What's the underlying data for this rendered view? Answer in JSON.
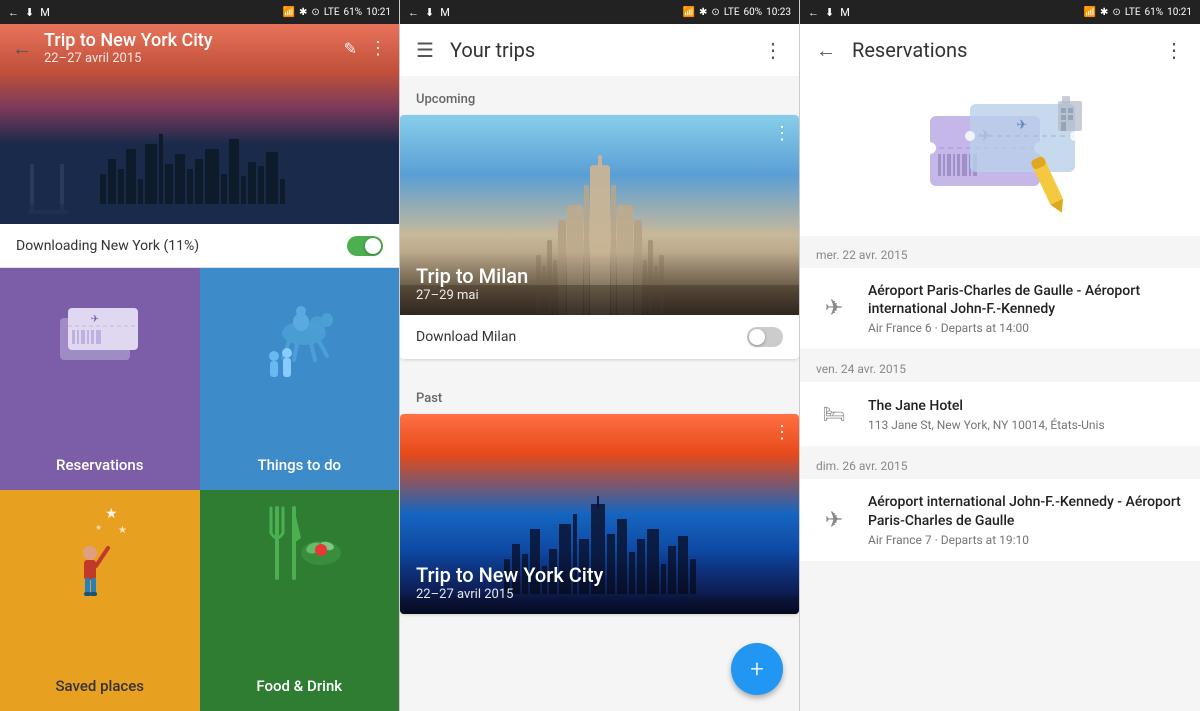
{
  "panel1": {
    "status": {
      "time": "10:21",
      "battery": "61%",
      "signal": "LTE"
    },
    "header": {
      "title": "Trip to New York City",
      "dates": "22–27 avril 2015"
    },
    "download": {
      "text": "Downloading New York (11%)",
      "toggle": "on"
    },
    "tiles": [
      {
        "id": "reservations",
        "label": "Reservations",
        "color": "purple"
      },
      {
        "id": "things-to-do",
        "label": "Things to do",
        "color": "blue"
      },
      {
        "id": "saved-places",
        "label": "Saved places",
        "color": "yellow"
      },
      {
        "id": "food-drink",
        "label": "Food & Drink",
        "color": "green"
      }
    ]
  },
  "panel2": {
    "status": {
      "time": "10:23",
      "battery": "60%"
    },
    "header": {
      "title": "Your trips"
    },
    "sections": {
      "upcoming_label": "Upcoming",
      "past_label": "Past"
    },
    "trips": [
      {
        "id": "milan",
        "title": "Trip to Milan",
        "dates": "27–29 mai",
        "type": "upcoming",
        "download_label": "Download Milan"
      },
      {
        "id": "nyc",
        "title": "Trip to New York City",
        "dates": "22–27 avril 2015",
        "type": "past"
      }
    ],
    "fab_label": "+"
  },
  "panel3": {
    "status": {
      "time": "10:21",
      "battery": "61%"
    },
    "header": {
      "title": "Reservations"
    },
    "reservations": [
      {
        "date_label": "mer. 22 avr. 2015",
        "type": "flight",
        "title": "Aéroport Paris-Charles de Gaulle - Aéroport international John-F.-Kennedy",
        "subtitle": "Air France 6 · Departs at 14:00"
      },
      {
        "date_label": "ven. 24 avr. 2015",
        "type": "hotel",
        "title": "The Jane Hotel",
        "subtitle": "113 Jane St, New York, NY 10014, États-Unis"
      },
      {
        "date_label": "dim. 26 avr. 2015",
        "type": "flight",
        "title": "Aéroport international John-F.-Kennedy - Aéroport Paris-Charles de Gaulle",
        "subtitle": "Air France 7 · Departs at 19:10"
      }
    ]
  }
}
